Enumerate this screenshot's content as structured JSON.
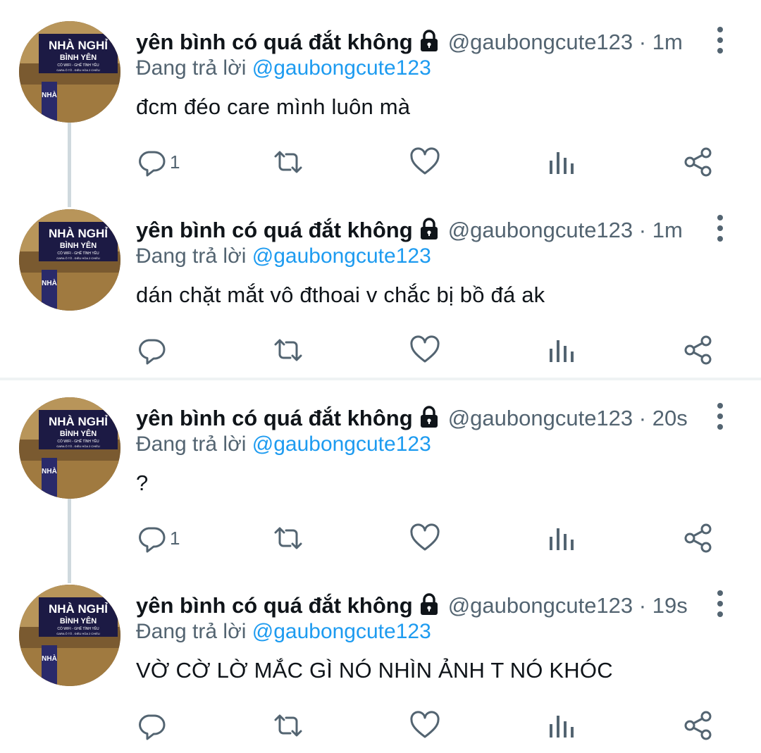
{
  "colors": {
    "name": "#0f1419",
    "secondary": "#536471",
    "mention": "#1d9bf0",
    "thread_line": "#cfd9de"
  },
  "tweets": [
    {
      "display_name": "yên bình có quá đắt không",
      "handle_time": "@gaubongcute123 · 1m",
      "reply_prefix": "Đang trả lời",
      "reply_to": "@gaubongcute123",
      "text": "đcm đéo care mình luôn mà",
      "reply_count": "1"
    },
    {
      "display_name": "yên bình có quá đắt không",
      "handle_time": "@gaubongcute123 · 1m",
      "reply_prefix": "Đang trả lời",
      "reply_to": "@gaubongcute123",
      "text": "dán chặt mắt vô đthoai v chắc bị bồ đá ak",
      "reply_count": ""
    },
    {
      "display_name": "yên bình có quá đắt không",
      "handle_time": "@gaubongcute123 · 20s",
      "reply_prefix": "Đang trả lời",
      "reply_to": "@gaubongcute123",
      "text": "?",
      "reply_count": "1"
    },
    {
      "display_name": "yên bình có quá đắt không",
      "handle_time": "@gaubongcute123 · 19s",
      "reply_prefix": "Đang trả lời",
      "reply_to": "@gaubongcute123",
      "text": "VỜ CỜ LỜ MẮC GÌ NÓ NHÌN ẢNH T NÓ KHÓC",
      "reply_count": ""
    }
  ],
  "avatar_sign": {
    "line1": "NHÀ NGHỈ",
    "line2": "BÌNH YÊN",
    "line3": "CÓ WIFI - GHẾ TÌNH YÊU",
    "line4": "GARA Ô TÔ - ĐIỀU HÒA 2 CHIỀU",
    "side": "NHÀ"
  },
  "icons": [
    "lock-icon",
    "more-icon",
    "reply-icon",
    "retweet-icon",
    "like-icon",
    "analytics-icon",
    "share-icon"
  ]
}
